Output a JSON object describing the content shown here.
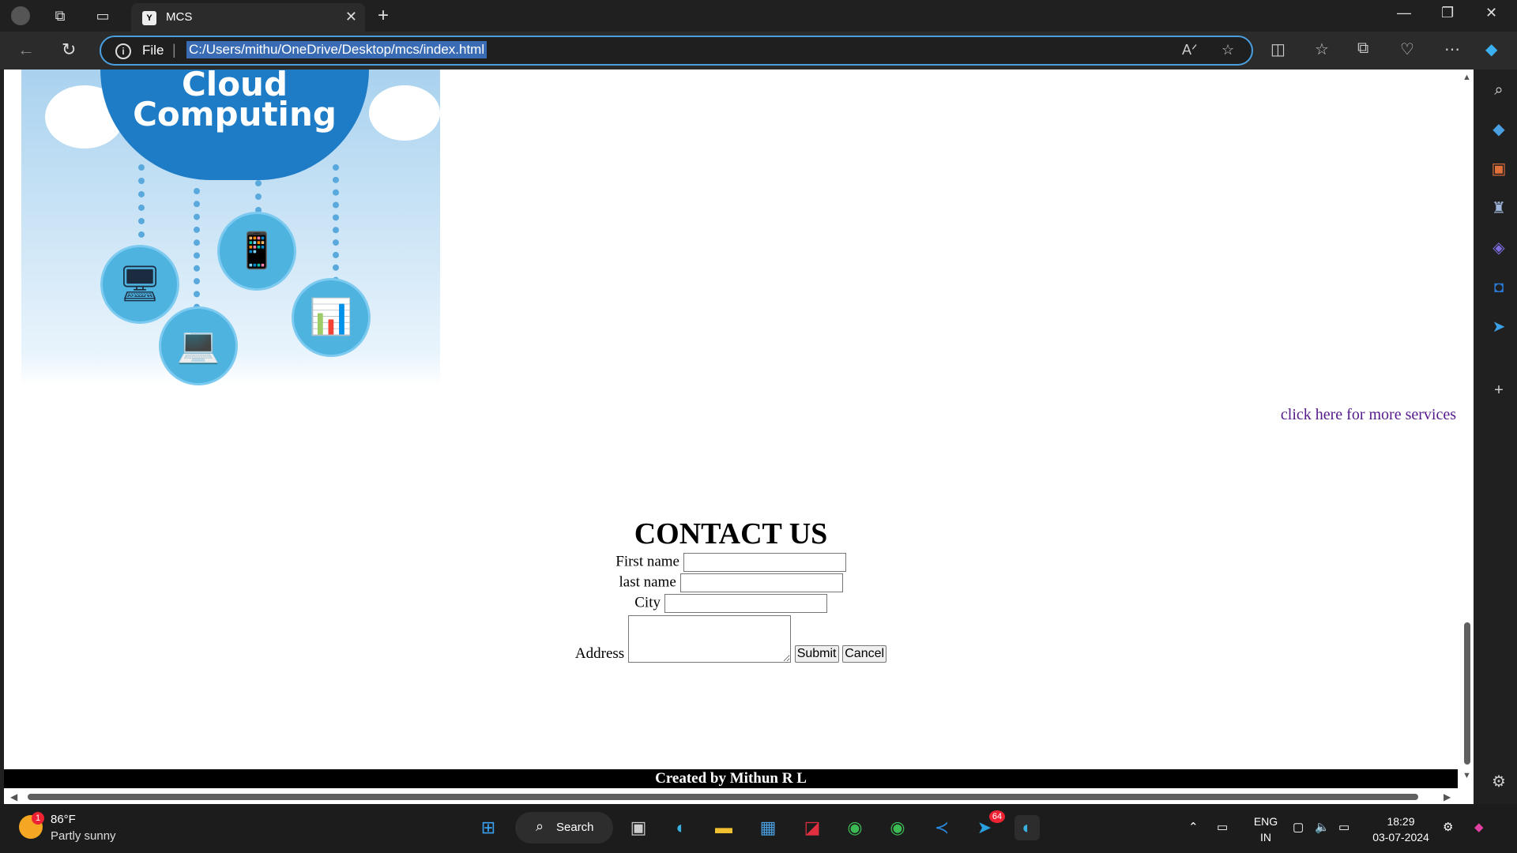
{
  "browser": {
    "tab_title": "MCS",
    "tab_favicon": "Y",
    "address_scheme_label": "File",
    "address_url": "C:/Users/mithu/OneDrive/Desktop/mcs/index.html"
  },
  "page": {
    "hero_title_line1": "Cloud",
    "hero_title_line2": "Computing",
    "more_services_link": "click here for more services",
    "contact_heading": "CONTACT US",
    "fields": {
      "first_name_label": "First name",
      "last_name_label": "last name",
      "city_label": "City",
      "address_label": "Address"
    },
    "submit_label": "Submit",
    "cancel_label": "Cancel",
    "footer_text": "Created by Mithun R L"
  },
  "taskbar": {
    "temperature": "86°F",
    "condition": "Partly sunny",
    "weather_badge": "1",
    "search_label": "Search",
    "lang_line1": "ENG",
    "lang_line2": "IN",
    "time": "18:29",
    "date": "03-07-2024",
    "telegram_badge": "64"
  },
  "colors": {
    "accent": "#4a9fe0",
    "link_visited": "#551a8b",
    "footer_bg": "#000000"
  }
}
